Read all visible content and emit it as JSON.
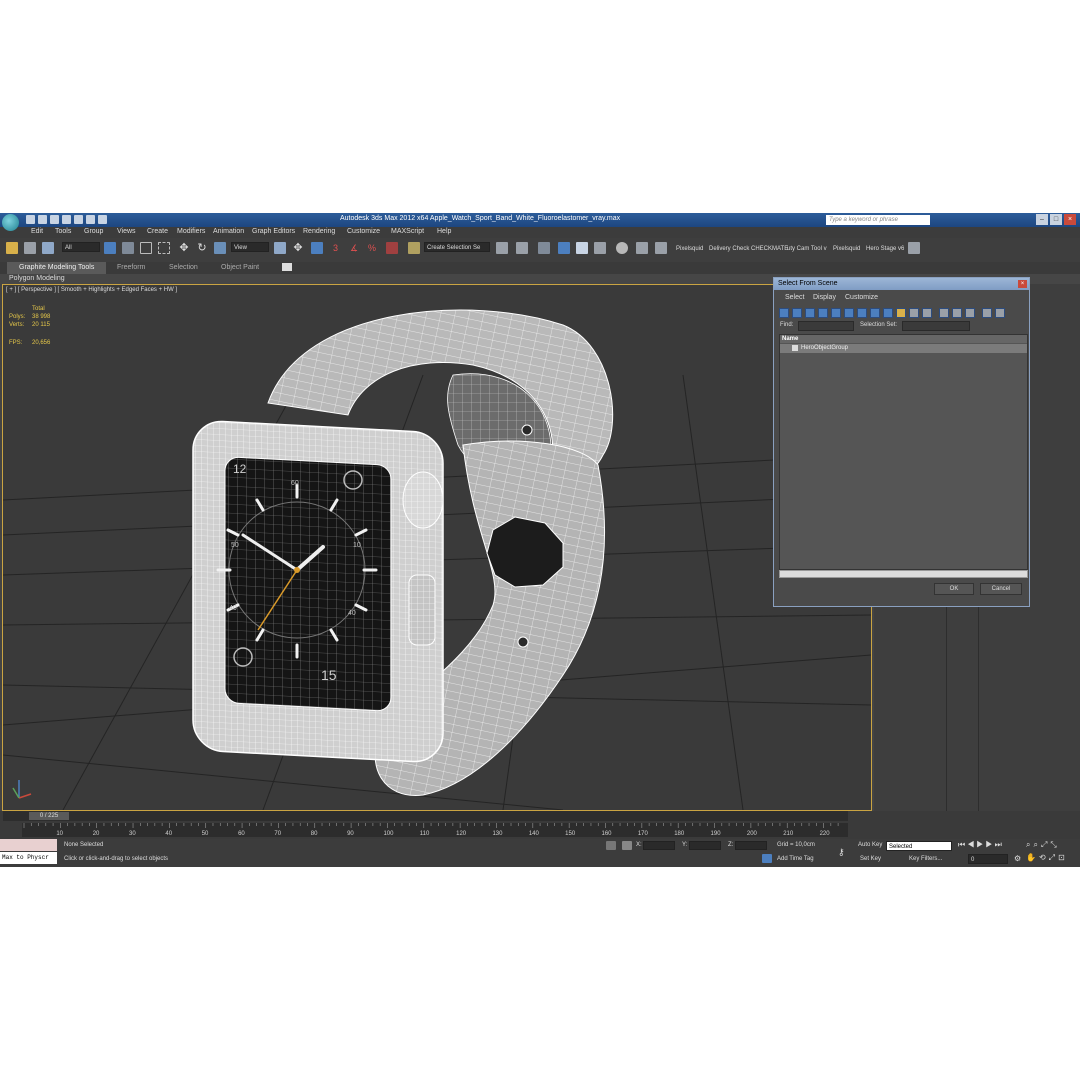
{
  "app": {
    "title": "Autodesk 3ds Max  2012 x64     Apple_Watch_Sport_Band_White_Fluoroelastomer_vray.max",
    "search_placeholder": "Type a keyword or phrase"
  },
  "menu": [
    "Edit",
    "Tools",
    "Group",
    "Views",
    "Create",
    "Modifiers",
    "Animation",
    "Graph Editors",
    "Rendering",
    "Customize",
    "MAXScript",
    "Help"
  ],
  "toolbar": {
    "filter_value": "All",
    "refcoord_value": "View",
    "selection_set_value": "Create Selection Se",
    "custom_tools": [
      "Pixelsquid",
      "Delivery Check",
      "CHECKMATE",
      "uty Cam Tool v",
      "Pixelsquid",
      "Hero Stage v6"
    ]
  },
  "ribbon": {
    "tabs": [
      "Graphite Modeling Tools",
      "Freeform",
      "Selection",
      "Object Paint"
    ],
    "panel": "Polygon Modeling"
  },
  "viewport": {
    "label": "[ + ] [ Perspective ] [ Smooth + Highlights + Edged Faces + HW ]",
    "stats": {
      "header": "Total",
      "polys_label": "Polys:",
      "polys": "38 998",
      "verts_label": "Verts:",
      "verts": "20 115",
      "fps_label": "FPS:",
      "fps": "20,656"
    },
    "watch": {
      "dial_numbers": [
        "12",
        "60",
        "40"
      ],
      "side_numbers": [
        "50",
        "10",
        "40"
      ],
      "watch_number": "15"
    },
    "accent_color": "#caa442"
  },
  "timeline": {
    "frame_readout": "0 / 225",
    "ticks": [
      "10",
      "20",
      "30",
      "40",
      "50",
      "60",
      "70",
      "80",
      "90",
      "100",
      "110",
      "120",
      "130",
      "140",
      "150",
      "160",
      "170",
      "180",
      "190",
      "200",
      "210",
      "220"
    ]
  },
  "status": {
    "maxscript_listener": "Max to Physcr",
    "selection": "None Selected",
    "prompt": "Click or click-and-drag to select objects",
    "x_label": "X:",
    "y_label": "Y:",
    "z_label": "Z:",
    "grid": "Grid = 10,0cm",
    "add_time_tag": "Add Time Tag",
    "auto_key": "Auto Key",
    "set_key": "Set Key",
    "key_mode_value": "Selected",
    "key_filters": "Key Filters...",
    "frame_value": "0"
  },
  "dialog": {
    "title": "Select From Scene",
    "menu": [
      "Select",
      "Display",
      "Customize"
    ],
    "find_label": "Find:",
    "selection_set_label": "Selection Set:",
    "column_name": "Name",
    "items": [
      "HeroObjectGroup"
    ],
    "ok": "OK",
    "cancel": "Cancel"
  }
}
